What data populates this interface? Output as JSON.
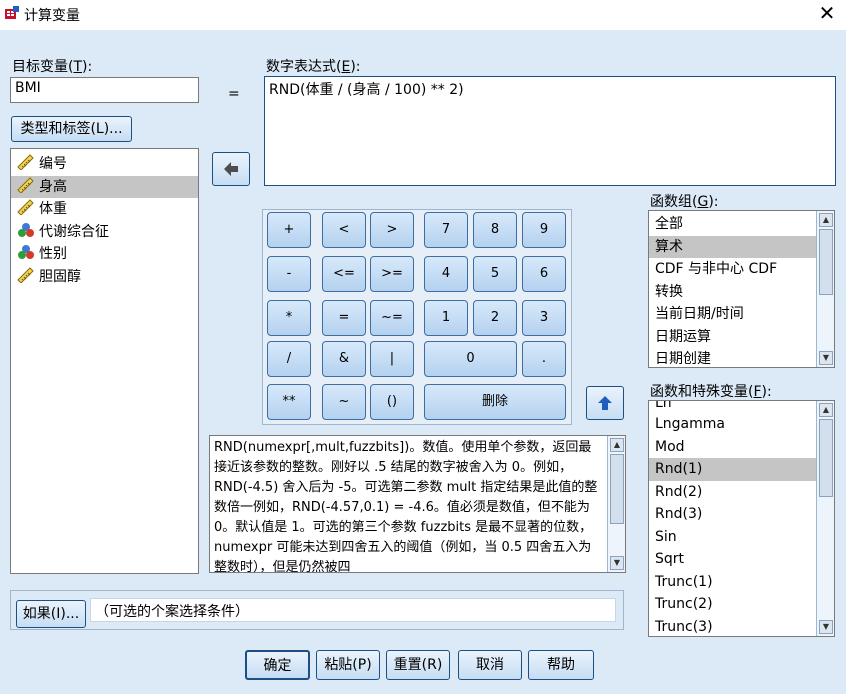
{
  "window": {
    "title": "计算变量",
    "close": "✕"
  },
  "target": {
    "label": "目标变量(",
    "key": "T",
    "label_end": "):",
    "value": "BMI"
  },
  "equals": "=",
  "type_label_button": "类型和标签(L)...",
  "expression": {
    "label": "数字表达式(",
    "key": "E",
    "label_end": "):",
    "value": "RND(体重 / (身高 / 100) ** 2)"
  },
  "variables": [
    {
      "label": "编号",
      "icon": "scale-ruler-icon"
    },
    {
      "label": "身高",
      "icon": "scale-ruler-icon",
      "selected": true
    },
    {
      "label": "体重",
      "icon": "scale-ruler-icon"
    },
    {
      "label": "代谢综合征",
      "icon": "nominal-balls-icon"
    },
    {
      "label": "性别",
      "icon": "nominal-balls-icon"
    },
    {
      "label": "胆固醇",
      "icon": "scale-ruler-icon"
    }
  ],
  "keypad": {
    "plus": "+",
    "lt": "<",
    "gt": ">",
    "k7": "7",
    "k8": "8",
    "k9": "9",
    "minus": "-",
    "le": "<=",
    "ge": ">=",
    "k4": "4",
    "k5": "5",
    "k6": "6",
    "mul": "*",
    "eq": "=",
    "ne": "~=",
    "k1": "1",
    "k2": "2",
    "k3": "3",
    "div": "/",
    "and": "&",
    "or": "|",
    "k0": "0",
    "dot": ".",
    "pow": "**",
    "not": "~",
    "paren": "()",
    "delete": "删除"
  },
  "function_group": {
    "label": "函数组(",
    "key": "G",
    "label_end": "):",
    "items": [
      "全部",
      "算术",
      "CDF 与非中心 CDF",
      "转换",
      "当前日期/时间",
      "日期运算",
      "日期创建"
    ],
    "selected_index": 1
  },
  "functions": {
    "label": "函数和特殊变量(",
    "key": "F",
    "label_end": "):",
    "partial_top": "Ln",
    "items": [
      "Lngamma",
      "Mod",
      "Rnd(1)",
      "Rnd(2)",
      "Rnd(3)",
      "Sin",
      "Sqrt",
      "Trunc(1)",
      "Trunc(2)",
      "Trunc(3)"
    ],
    "selected_index": 2
  },
  "description": "RND(numexpr[,mult,fuzzbits])。数值。使用单个参数，返回最接近该参数的整数。刚好以 .5 结尾的数字被舍入为 0。例如，RND(-4.5) 舍入后为 -5。可选第二参数 mult 指定结果是此值的整数倍一例如，RND(-4.57,0.1) = -4.6。值必须是数值，但不能为 0。默认值是 1。可选的第三个参数 fuzzbits 是最不显著的位数，numexpr 可能未达到四舍五入的阈值（例如，当 0.5 四舍五入为整数时），但是仍然被四",
  "if_button": "如果(I)...",
  "if_condition": "（可选的个案选择条件）",
  "buttons": {
    "ok": "确定",
    "paste": "粘贴(P)",
    "reset": "重置(R)",
    "cancel": "取消",
    "help": "帮助"
  }
}
